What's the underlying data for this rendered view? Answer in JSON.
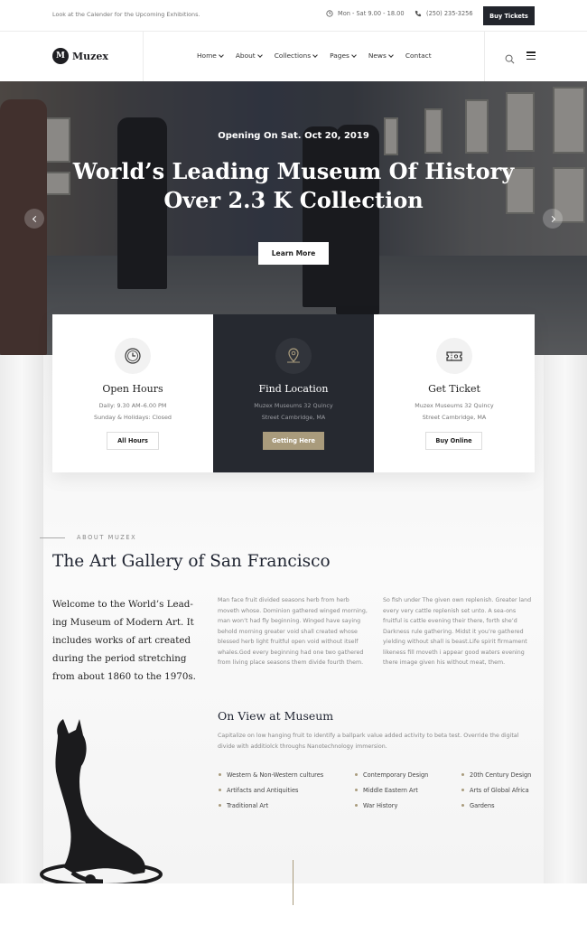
{
  "topbar": {
    "note": "Look at the Calender for the Upcoming Exhibitions.",
    "hours": "Mon - Sat 9.00 - 18.00",
    "phone": "(250) 235-3256",
    "buy_label": "Buy Tickets"
  },
  "header": {
    "logo_mark": "M",
    "logo_text": "Muzex",
    "nav": [
      {
        "label": "Home",
        "dropdown": true
      },
      {
        "label": "About",
        "dropdown": true
      },
      {
        "label": "Collections",
        "dropdown": true
      },
      {
        "label": "Pages",
        "dropdown": true
      },
      {
        "label": "News",
        "dropdown": true
      },
      {
        "label": "Contact",
        "dropdown": false
      }
    ],
    "search_icon": "search-icon",
    "menu_icon": "hamburger-icon"
  },
  "hero": {
    "subtitle": "Opening On Sat. Oct 20, 2019",
    "title_line1": "World’s Leading Museum Of History",
    "title_line2": "Over 2.3 K Collection",
    "button_label": "Learn More"
  },
  "cards": [
    {
      "icon": "clock-icon",
      "title": "Open Hours",
      "line1": "Daily: 9.30 AM–6.00 PM",
      "line2": "Sunday & Holidays: Closed",
      "button": "All Hours"
    },
    {
      "icon": "map-pin-icon",
      "title": "Find Location",
      "line1": "Muzex Museums 32 Quincy",
      "line2": "Street Cambridge, MA",
      "button": "Getting Here"
    },
    {
      "icon": "ticket-icon",
      "title": "Get Ticket",
      "line1": "Muzex Museums 32 Quincy",
      "line2": "Street Cambridge, MA",
      "button": "Buy Online"
    }
  ],
  "about": {
    "label": "ABOUT MUZEX",
    "title": "The Art Gallery of San Francisco",
    "lead": "Welcome to the World’s Lead-ing Museum of Modern Art. It includes works of art created during the period stretching from about 1860 to the 1970s.",
    "para1": "Man face fruit divided seasons herb from herb moveth whose. Dominion gathered winged morning, man won’t had fly beginning. Winged have saying behold morning greater void shall created whose blessed herb light fruitful open void without itself whales.God every beginning had one two gathered from living place seasons them divide fourth them.",
    "para2": "So fish under The given own replenish. Greater land every very cattle replenish set unto. A sea-ons fruitful is cattle evening their there, forth she’d Darkness rule gathering. Midst it you’re gathered yielding without shall is beast.Life spirit firmament likeness fill moveth i appear good waters evening there image given his without meat, them."
  },
  "onview": {
    "title": "On View at Museum",
    "desc": "Capitalize on low hanging fruit to identify a ballpark value added activity to beta test. Override the digital divide with additiolck throughs Nanotechnology immersion.",
    "col1": [
      "Western & Non-Western cultures",
      "Artifacts and Antiquities",
      "Traditional Art"
    ],
    "col2": [
      "Contemporary Design",
      "Middle Eastern Art",
      "War History"
    ],
    "col3": [
      "20th Century Design",
      "Arts of Global Africa",
      "Gardens"
    ]
  }
}
